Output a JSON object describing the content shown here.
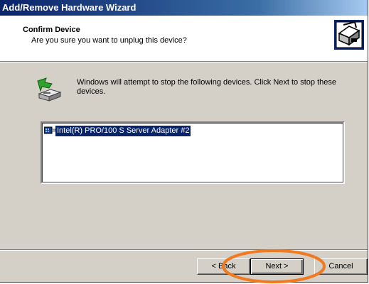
{
  "window": {
    "title": "Add/Remove Hardware Wizard"
  },
  "header": {
    "title": "Confirm Device",
    "subtitle": "Are you sure you want to unplug this device?",
    "icon": "hardware-wizard-icon"
  },
  "body": {
    "icon": "eject-device-icon",
    "message": "Windows will attempt to stop the following devices.  Click Next to stop these devices."
  },
  "device_list": {
    "items": [
      {
        "icon": "network-adapter-icon",
        "label": "Intel(R) PRO/100 S Server Adapter #2",
        "selected": true
      }
    ]
  },
  "buttons": {
    "back_label": "< Back",
    "next_label": "Next >",
    "cancel_label": "Cancel"
  },
  "annotation": {
    "shape": "ellipse",
    "target": "next-button",
    "color": "#f07a20"
  },
  "colors": {
    "title_bar": "#0a246a",
    "selection": "#0a246a",
    "dialog_face": "#d4d0c8"
  }
}
